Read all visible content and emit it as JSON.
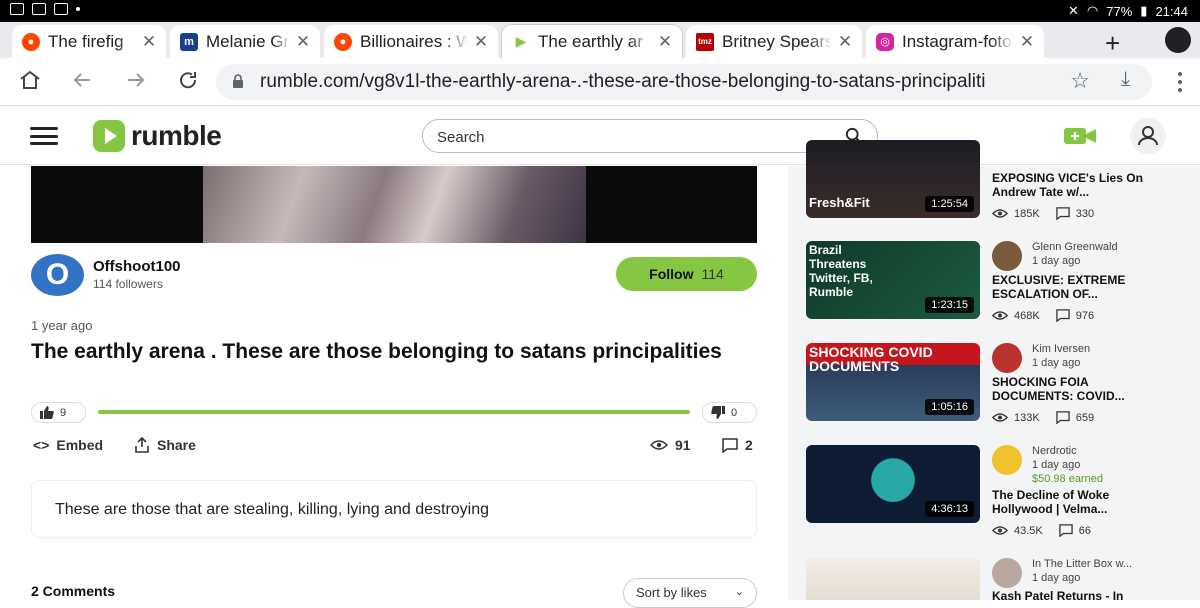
{
  "status": {
    "battery": "77%",
    "time": "21:44"
  },
  "tabs": [
    {
      "label": "The firefig",
      "favicon": "reddit-icon",
      "color": "#ff4500"
    },
    {
      "label": "Melanie Griffit",
      "favicon": "m-icon",
      "color": "#1a3e8c"
    },
    {
      "label": "Billionaires : W",
      "favicon": "reddit-icon",
      "color": "#ff4500"
    },
    {
      "label": "The earthly ar",
      "favicon": "rumble-icon",
      "color": "#85c742"
    },
    {
      "label": "Britney Spears",
      "favicon": "tmz-icon",
      "color": "#b40000"
    },
    {
      "label": "Instagram-foto",
      "favicon": "instagram-icon",
      "color": "#d6249f"
    }
  ],
  "address": {
    "url": "rumble.com/vg8v1l-the-earthly-arena-.-these-are-those-belonging-to-satans-principaliti"
  },
  "header": {
    "logo_text": "rumble",
    "search_placeholder": "Search"
  },
  "video": {
    "channel_initial": "O",
    "channel_name": "Offshoot100",
    "followers": "114 followers",
    "follow_label": "Follow",
    "follow_count": "114",
    "posted": "1 year ago",
    "title": "The earthly arena . These are those belonging to satans principalities",
    "upvotes": "9",
    "downvotes": "0",
    "upvote_fraction": 1.0,
    "embed_label": "Embed",
    "share_label": "Share",
    "views": "91",
    "comments_count": "2",
    "description": "These are those that are stealing, killing, lying and destroying",
    "comments_label": "2 Comments",
    "sort_label": "Sort by likes"
  },
  "sidebar": [
    {
      "duration": "1:25:54",
      "thumb_text": "Fresh&Fit",
      "thumb_color": "#1c1c24",
      "channel": "",
      "date": "",
      "earned": "",
      "title": "EXPOSING VICE's Lies On Andrew Tate w/...",
      "views": "185K",
      "comments": "330"
    },
    {
      "duration": "1:23:15",
      "thumb_text": "Brazil Threatens Twitter, FB, Rumble",
      "thumb_color": "#0f3a2a",
      "channel": "Glenn Greenwald",
      "date": "1 day ago",
      "earned": "",
      "title": "EXCLUSIVE: EXTREME ESCALATION OF...",
      "views": "468K",
      "comments": "976",
      "avatar_color": "#7a5a3c"
    },
    {
      "duration": "1:05:16",
      "thumb_text": "SHOCKING COVID DOCUMENTS",
      "thumb_color": "#2a3c5a",
      "channel": "Kim Iversen",
      "date": "1 day ago",
      "earned": "",
      "title": "SHOCKING FOIA DOCUMENTS: COVID...",
      "views": "133K",
      "comments": "659",
      "avatar_color": "#b8322e"
    },
    {
      "duration": "4:36:13",
      "thumb_text": "",
      "thumb_color": "#0d1b33",
      "channel": "Nerdrotic",
      "date": "1 day ago",
      "earned": "$50.98 earned",
      "title": "The Decline of Woke Hollywood | Velma...",
      "views": "43.5K",
      "comments": "66",
      "avatar_color": "#f2c12e"
    },
    {
      "duration": "",
      "thumb_text": "",
      "thumb_color": "#e9e4de",
      "channel": "In The Litter Box w...",
      "date": "1 day ago",
      "earned": "",
      "title": "Kash Patel Returns - In",
      "views": "",
      "comments": "",
      "avatar_color": "#b8a8a0"
    }
  ]
}
